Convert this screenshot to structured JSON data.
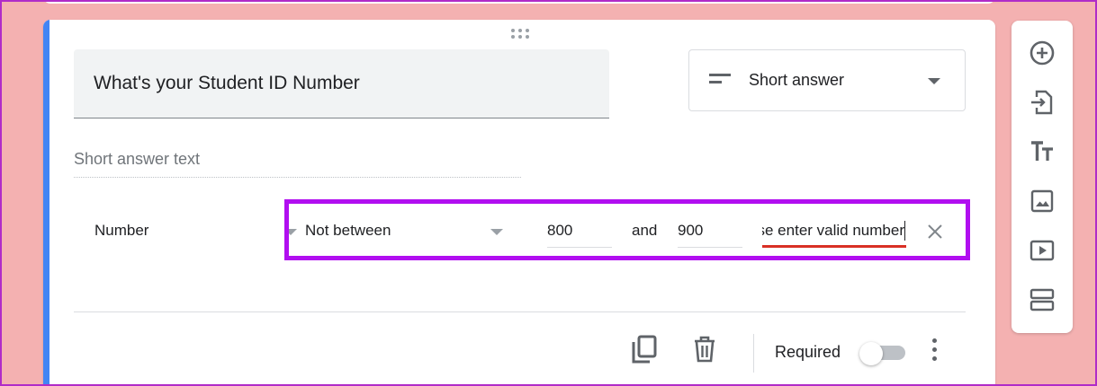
{
  "question": {
    "title": "What's your Student ID Number",
    "type_label": "Short answer",
    "answer_placeholder": "Short answer text"
  },
  "validation": {
    "type": "Number",
    "condition": "Not between",
    "min_value": "800",
    "and_label": "and",
    "max_value": "900",
    "error_text": "Please enter valid number"
  },
  "footer": {
    "required_label": "Required",
    "required_on": false
  },
  "toolbar": {
    "items": [
      "add-question",
      "import-questions",
      "add-title-description",
      "add-image",
      "add-video",
      "add-section"
    ]
  },
  "colors": {
    "accent": "#4285f4",
    "highlight": "#b10ef0",
    "error": "#d93025"
  }
}
